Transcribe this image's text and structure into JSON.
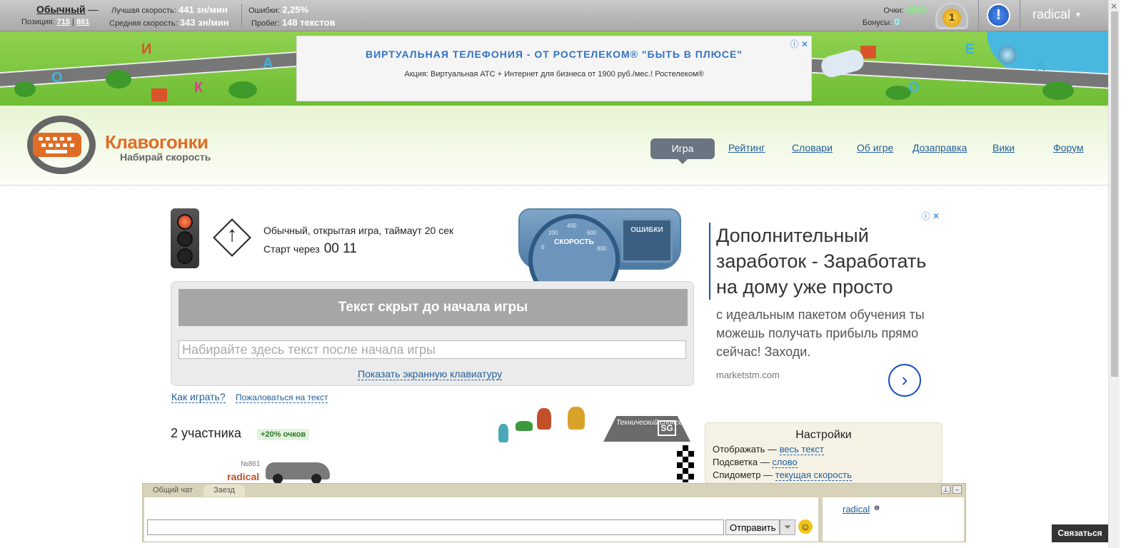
{
  "topbar": {
    "mode": "Обычный",
    "mode_dash": "—",
    "position_label": "Позиция:",
    "position_1": "715",
    "position_2": "861",
    "best_speed_label": "Лучшая скорость:",
    "best_speed": "441 зн/мин",
    "avg_speed_label": "Средняя скорость:",
    "avg_speed": "343 зн/мин",
    "errors_label": "Ошибки:",
    "errors": "2,25%",
    "mileage_label": "Пробег:",
    "mileage": "148 текстов",
    "score_label": "Очки:",
    "score": "2893",
    "bonus_label": "Бонусы:",
    "bonus": "0",
    "level": "1",
    "alert": "!",
    "username": "radical"
  },
  "banner": {
    "letters": [
      "О",
      "И",
      "А",
      "К",
      "Е",
      "А",
      "О"
    ],
    "ad_title": "ВИРТУАЛЬНАЯ ТЕЛЕФОНИЯ - ОТ РОСТЕЛЕКОМ® \"БЫТЬ В ПЛЮСЕ\"",
    "ad_text": "Акция: Виртуальная АТС + Интернет для бизнеса от 1900 руб./мес.! Ростелеком®",
    "ad_icons": "ⓘ ✕"
  },
  "header": {
    "brand": "Клавогонки",
    "tagline": "Набирай скорость",
    "nav": [
      "Игра",
      "Рейтинг",
      "Словари",
      "Об игре",
      "Дозаправка",
      "Вики",
      "Форум"
    ]
  },
  "game": {
    "info": "Обычный, открытая игра, таймаут 20 сек",
    "start_label": "Старт через",
    "timer": "00 11",
    "gauge_label": "СКОРОСТЬ",
    "gauge_ticks": [
      "0",
      "200",
      "400",
      "600",
      "800"
    ],
    "errors_label": "ОШИБКИ",
    "hidden_text": "Текст скрыт до начала игры",
    "input_placeholder": "Набирайте здесь текст после начала игры",
    "keyboard_link": "Показать экранную клавиатуру",
    "howto": "Как играть?",
    "complain": "Пожаловаться на текст",
    "participants": "2 участника",
    "bonus_badge": "+20% очков",
    "racer_num": "№861",
    "racer_name": "radical",
    "sponsor_text": "Технический спонсор",
    "sponsor_logo": "SG"
  },
  "right_ad": {
    "icons": "ⓘ ✕",
    "headline": "Дополнительный заработок - Заработать на дому уже просто",
    "body": "с идеальным пакетом обучения ты можешь получать прибыль прямо сейчас! Заходи.",
    "url": "marketstm.com",
    "arrow": "›"
  },
  "settings": {
    "title": "Настройки",
    "rows": [
      {
        "label": "Отображать —",
        "value": "весь текст"
      },
      {
        "label": "Подсветка —",
        "value": "слово"
      },
      {
        "label": "Спидометр —",
        "value": "текущая скорость"
      }
    ]
  },
  "chat": {
    "tabs": [
      "Общий чат",
      "Заезд"
    ],
    "send": "Отправить",
    "user": "radical",
    "info_icon": "❶",
    "contact": "Связаться"
  }
}
